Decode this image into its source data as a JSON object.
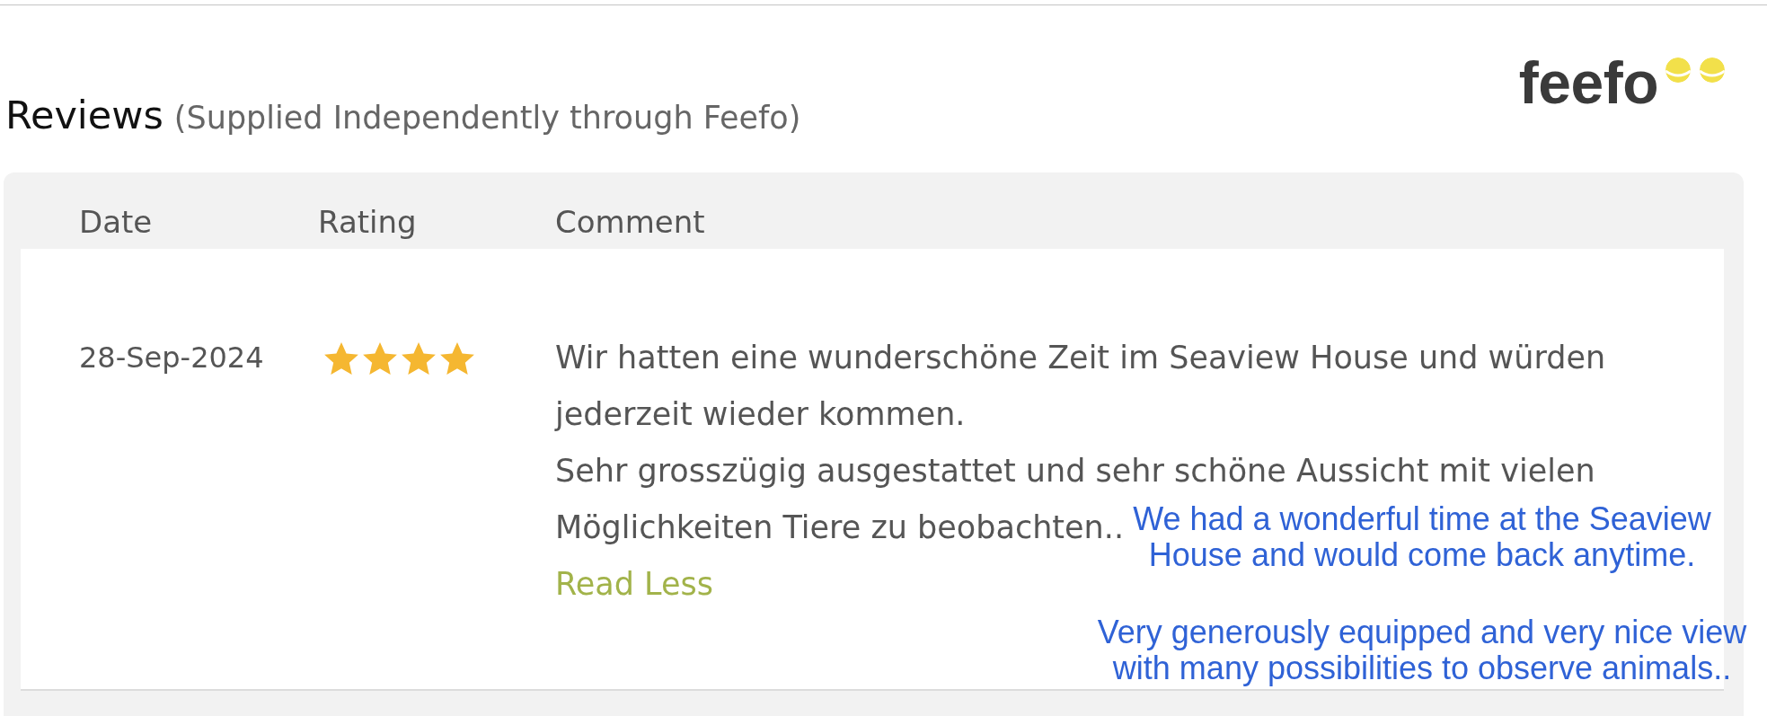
{
  "header": {
    "title": "Reviews",
    "subtitle": "(Supplied Independently through Feefo)",
    "logo": {
      "text": "feefo"
    }
  },
  "table": {
    "columns": [
      "Date",
      "Rating",
      "Comment"
    ],
    "rows": [
      {
        "date": "28-Sep-2024",
        "stars": 4,
        "comment": [
          "Wir hatten eine wunderschöne Zeit im Seaview House und würden jederzeit wieder kommen.",
          "Sehr grosszügig ausgestattet und sehr schöne Aussicht mit vielen",
          "Möglichkeiten Tiere zu beobachten.."
        ],
        "toggle_link": "Read Less"
      }
    ]
  },
  "translation_note": [
    "We had a wonderful time at the Seaview House and would come back anytime.",
    "Very generously equipped and very nice view with many possibilities to observe animals.."
  ]
}
